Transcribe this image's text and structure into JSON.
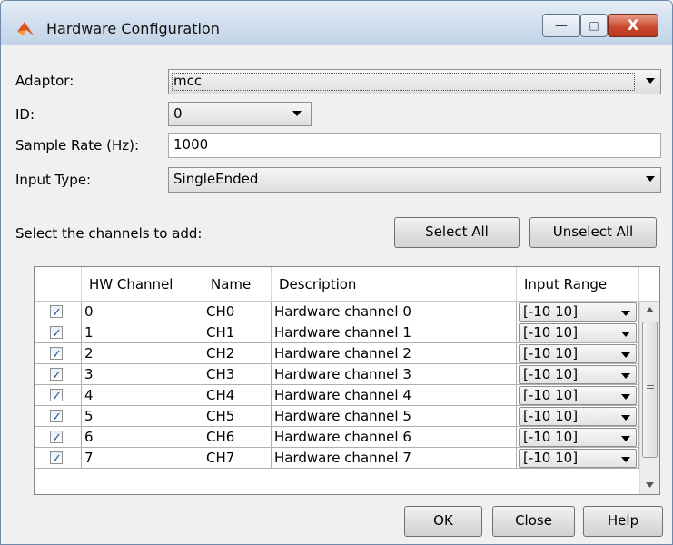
{
  "window": {
    "title": "Hardware Configuration"
  },
  "titlebar_buttons": {
    "minimize": "—",
    "maximize": "□",
    "close": "X"
  },
  "form": {
    "adaptor_label": "Adaptor:",
    "adaptor_value": "mcc",
    "id_label": "ID:",
    "id_value": "0",
    "sample_rate_label": "Sample Rate (Hz):",
    "sample_rate_value": "1000",
    "input_type_label": "Input Type:",
    "input_type_value": "SingleEnded"
  },
  "channels": {
    "prompt": "Select the channels to add:",
    "select_all": "Select All",
    "unselect_all": "Unselect All",
    "columns": [
      "",
      "HW Channel",
      "Name",
      "Description",
      "Input Range"
    ],
    "rows": [
      {
        "checked": true,
        "hw": "0",
        "name": "CH0",
        "description": "Hardware channel 0",
        "range": "[-10 10]"
      },
      {
        "checked": true,
        "hw": "1",
        "name": "CH1",
        "description": "Hardware channel 1",
        "range": "[-10 10]"
      },
      {
        "checked": true,
        "hw": "2",
        "name": "CH2",
        "description": "Hardware channel 2",
        "range": "[-10 10]"
      },
      {
        "checked": true,
        "hw": "3",
        "name": "CH3",
        "description": "Hardware channel 3",
        "range": "[-10 10]"
      },
      {
        "checked": true,
        "hw": "4",
        "name": "CH4",
        "description": "Hardware channel 4",
        "range": "[-10 10]"
      },
      {
        "checked": true,
        "hw": "5",
        "name": "CH5",
        "description": "Hardware channel 5",
        "range": "[-10 10]"
      },
      {
        "checked": true,
        "hw": "6",
        "name": "CH6",
        "description": "Hardware channel 6",
        "range": "[-10 10]"
      },
      {
        "checked": true,
        "hw": "7",
        "name": "CH7",
        "description": "Hardware channel 7",
        "range": "[-10 10]"
      }
    ]
  },
  "footer": {
    "ok": "OK",
    "close": "Close",
    "help": "Help"
  },
  "colors": {
    "window_bg": "#f0f0f0",
    "titlebar": "#cfdded",
    "close_button": "#c7462c",
    "check": "#1f4e8c"
  }
}
